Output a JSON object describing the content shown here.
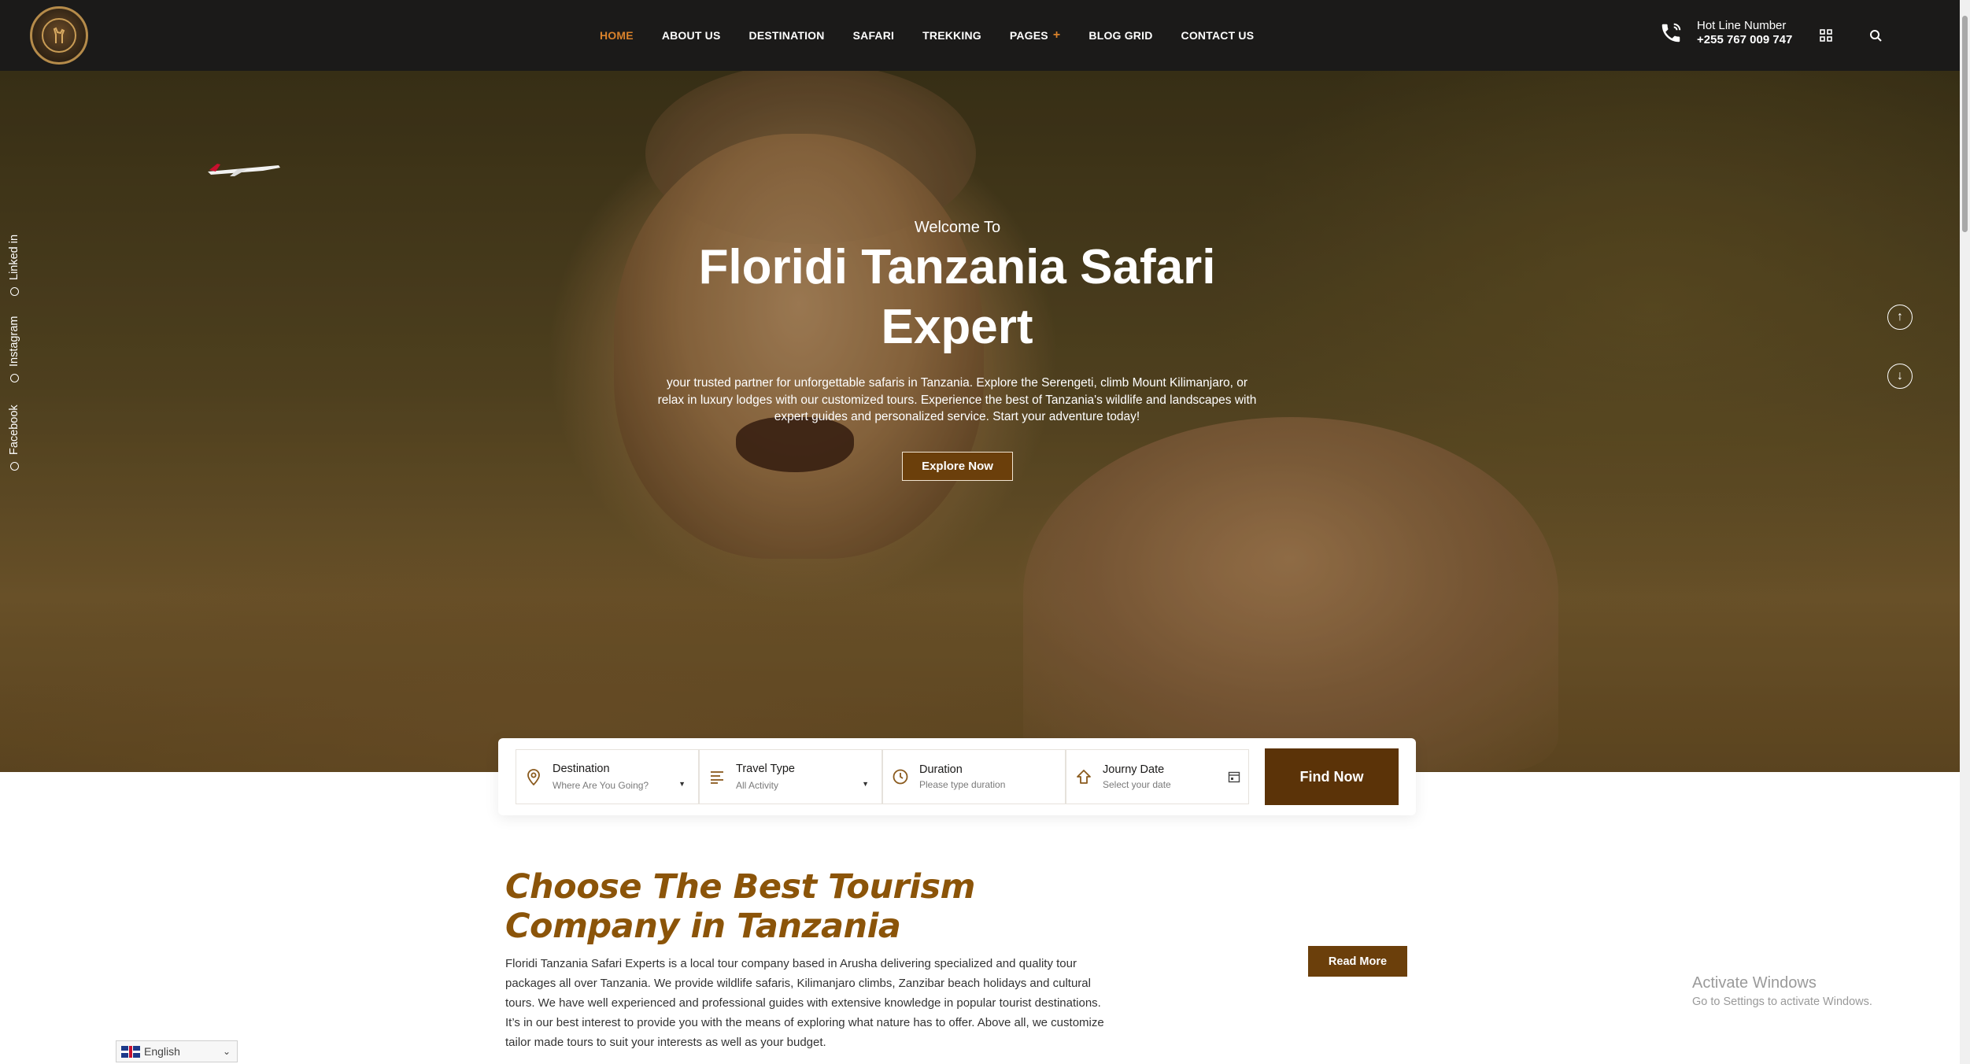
{
  "header": {
    "nav": [
      {
        "label": "HOME",
        "active": true
      },
      {
        "label": "ABOUT US"
      },
      {
        "label": "DESTINATION"
      },
      {
        "label": "SAFARI"
      },
      {
        "label": "TREKKING"
      },
      {
        "label": "PAGES",
        "plus": "+"
      },
      {
        "label": "BLOG GRID"
      },
      {
        "label": "CONTACT US"
      }
    ],
    "hotline_label": "Hot Line Number",
    "hotline_number": "+255 767 009 747",
    "icons": [
      "phone-icon",
      "grid-icon",
      "search-icon"
    ],
    "accent_color": "#d9822b"
  },
  "hero": {
    "welcome": "Welcome To",
    "title": "Floridi Tanzania Safari Expert",
    "description": "your trusted partner for unforgettable safaris in Tanzania. Explore the Serengeti, climb Mount Kilimanjaro, or relax in luxury lodges with our customized tours. Experience the best of Tanzania's wildlife and landscapes with expert guides and personalized service. Start your adventure today!",
    "cta": "Explore Now",
    "social": [
      "Linked in",
      "Instagram",
      "Facebook"
    ]
  },
  "search": {
    "fields": [
      {
        "label": "Destination",
        "value": "Where Are You Going?",
        "icon": "map-pin-icon"
      },
      {
        "label": "Travel Type",
        "value": "All Activity",
        "icon": "list-icon"
      },
      {
        "label": "Duration",
        "value": "Please type duration",
        "icon": "clock-icon"
      },
      {
        "label": "Journy Date",
        "value": "Select your date",
        "icon": "calendar-arrow-icon"
      }
    ],
    "button": "Find Now"
  },
  "about": {
    "title": "Choose The Best Tourism Company in Tanzania",
    "text": "Floridi Tanzania Safari Experts is a local tour company based in Arusha delivering specialized and quality tour packages all over Tanzania. We provide wildlife safaris, Kilimanjaro climbs, Zanzibar beach holidays and cultural tours. We have well experienced and professional guides with extensive knowledge in popular tourist destinations. It’s in our best interest to provide you with the means of exploring what nature has to offer. Above all, we customize tailor made tours to suit your interests as well as your budget.",
    "button": "Read More"
  },
  "windows": {
    "title": "Activate Windows",
    "sub": "Go to Settings to activate Windows."
  },
  "language": {
    "selected": "English"
  },
  "colors": {
    "brand_brown": "#6b3f0b",
    "title_brown": "#8b5409",
    "header_bg": "#1b1a19"
  }
}
